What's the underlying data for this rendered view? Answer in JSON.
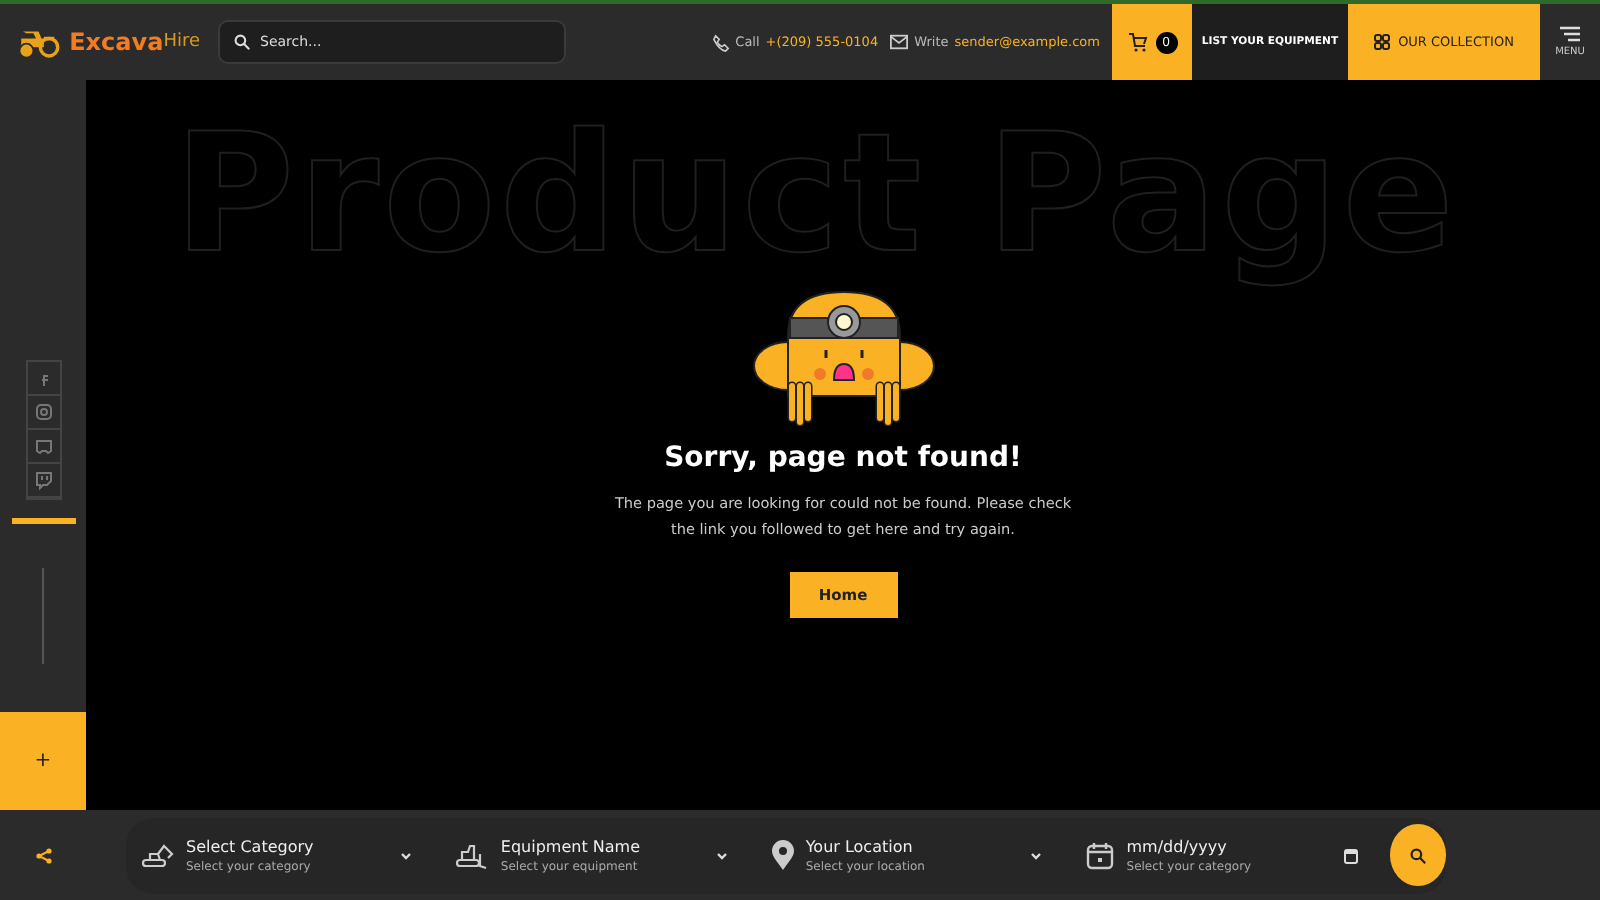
{
  "header": {
    "logo": {
      "primary": "Excava",
      "secondary": "Hire"
    },
    "search": {
      "placeholder": "Search..."
    },
    "contacts": [
      {
        "kind": "phone",
        "label": "Call",
        "value": "+(209) 555-0104"
      },
      {
        "kind": "mail",
        "label": "Write",
        "value": "sender@example.com"
      }
    ],
    "cart_count": "0",
    "list_button": "LIST YOUR EQUIPMENT",
    "collection_button": "OUR COLLECTION",
    "menu_label": "MENU"
  },
  "sidebar": {
    "plus": "+"
  },
  "main": {
    "background_heading": "Product Page",
    "title": "Sorry, page not found!",
    "message": "The page you are looking for could not be found. Please check the link you followed to get here and try again.",
    "button": "Home"
  },
  "filters": [
    {
      "kind": "select",
      "title": "Select Category",
      "subtitle": "Select your category"
    },
    {
      "kind": "select",
      "title": "Equipment Name",
      "subtitle": "Select your equipment"
    },
    {
      "kind": "select",
      "title": "Your Location",
      "subtitle": "Select your location"
    },
    {
      "kind": "date",
      "title": "mm/dd/yyyy",
      "subtitle": "Select your category"
    }
  ]
}
